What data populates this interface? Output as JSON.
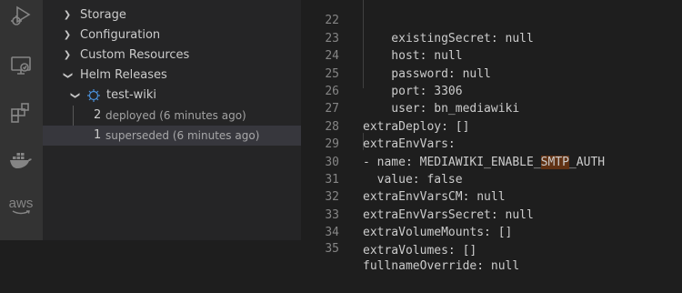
{
  "activity_bar": {
    "icons": [
      "run-debug-icon",
      "remote-explorer-icon",
      "extensions-icon",
      "docker-icon",
      "aws-icon"
    ],
    "aws_label": "aws"
  },
  "sidebar": {
    "items": [
      {
        "label": "Storage",
        "expanded": false
      },
      {
        "label": "Configuration",
        "expanded": false
      },
      {
        "label": "Custom Resources",
        "expanded": false
      },
      {
        "label": "Helm Releases",
        "expanded": true
      }
    ],
    "release": {
      "label": "test-wiki",
      "icon": "helm-icon"
    },
    "revisions": [
      {
        "number": "2",
        "status": "deployed (6 minutes ago)"
      },
      {
        "number": "1",
        "status": "superseded (6 minutes ago)",
        "selected": true
      }
    ]
  },
  "editor": {
    "lines": [
      {
        "n": "22",
        "text": "    existingSecret: null"
      },
      {
        "n": "23",
        "text": "    host: null"
      },
      {
        "n": "24",
        "text": "    password: null"
      },
      {
        "n": "25",
        "text": "    port: 3306"
      },
      {
        "n": "26",
        "text": "    user: bn_mediawiki"
      },
      {
        "n": "27",
        "text": "extraDeploy: []"
      },
      {
        "n": "28",
        "text": "extraEnvVars:"
      },
      {
        "n": "29",
        "pre": "- name: MEDIAWIKI_ENABLE_",
        "highlight": "SMTP",
        "post": "_AUTH"
      },
      {
        "n": "30",
        "text": "  value: false"
      },
      {
        "n": "31",
        "text": "extraEnvVarsCM: null"
      },
      {
        "n": "32",
        "text": "extraEnvVarsSecret: null"
      },
      {
        "n": "33",
        "text": "extraVolumeMounts: []"
      },
      {
        "n": "34",
        "text": "extraVolumes: []"
      },
      {
        "n": "35",
        "text": "fullnameOverride: null"
      }
    ]
  },
  "colors": {
    "activity_bar": "#333333",
    "sidebar": "#252526",
    "editor": "#1e1e1e",
    "selection": "#37373d",
    "find_highlight": "#613214"
  }
}
